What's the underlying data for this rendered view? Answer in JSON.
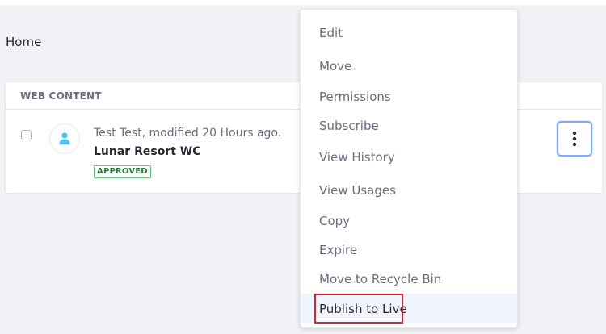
{
  "breadcrumb": {
    "label": "Home"
  },
  "panel": {
    "header": "WEB CONTENT",
    "entry": {
      "meta": "Test Test, modified 20 Hours ago.",
      "title": "Lunar Resort WC",
      "status": "APPROVED",
      "avatar_icon": "user-icon",
      "actions_icon": "ellipsis-vertical-icon"
    }
  },
  "menu": {
    "items": [
      {
        "label": "Edit"
      },
      {
        "label": "Move"
      },
      {
        "label": "Permissions"
      },
      {
        "label": "Subscribe"
      },
      {
        "label": "View History"
      },
      {
        "label": "View Usages"
      },
      {
        "label": "Copy"
      },
      {
        "label": "Expire"
      },
      {
        "label": "Move to Recycle Bin"
      },
      {
        "label": "Publish to Live"
      }
    ],
    "active_item": "Publish to Live"
  },
  "colors": {
    "accent": "#80acff",
    "status_green": "#287d3c",
    "highlight_red": "#d9232e",
    "avatar_blue": "#4bc3ff"
  }
}
